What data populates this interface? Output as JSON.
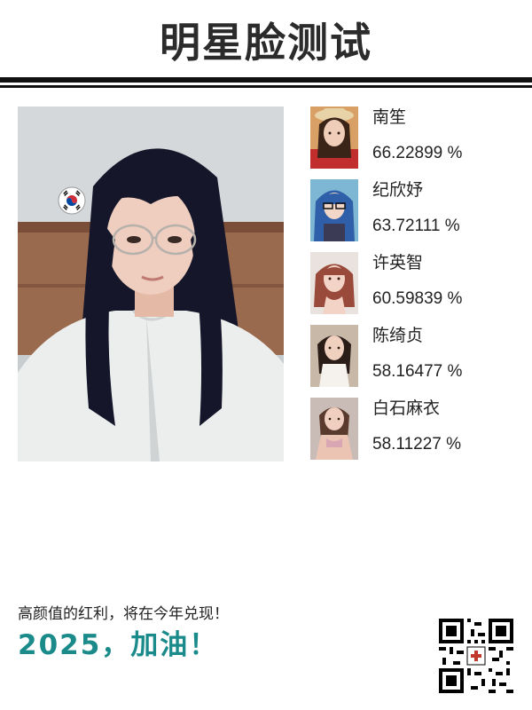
{
  "header": {
    "title": "明星脸测试"
  },
  "main_photo": {
    "flag_icon": "south-korea-flag-icon"
  },
  "results": [
    {
      "name": "南笙",
      "score": "66.22899 %"
    },
    {
      "name": "纪欣妤",
      "score": "63.72111 %"
    },
    {
      "name": "许英智",
      "score": "60.59839 %"
    },
    {
      "name": "陈绮贞",
      "score": "58.16477 %"
    },
    {
      "name": "白石麻衣",
      "score": "58.11227 %"
    }
  ],
  "footer": {
    "slogan": "高颜值的红利，将在今年兑现！",
    "motto": "2025，加油！"
  },
  "colors": {
    "accent": "#1a8a8a",
    "rule": "#111111",
    "title": "#2b2b2b"
  }
}
